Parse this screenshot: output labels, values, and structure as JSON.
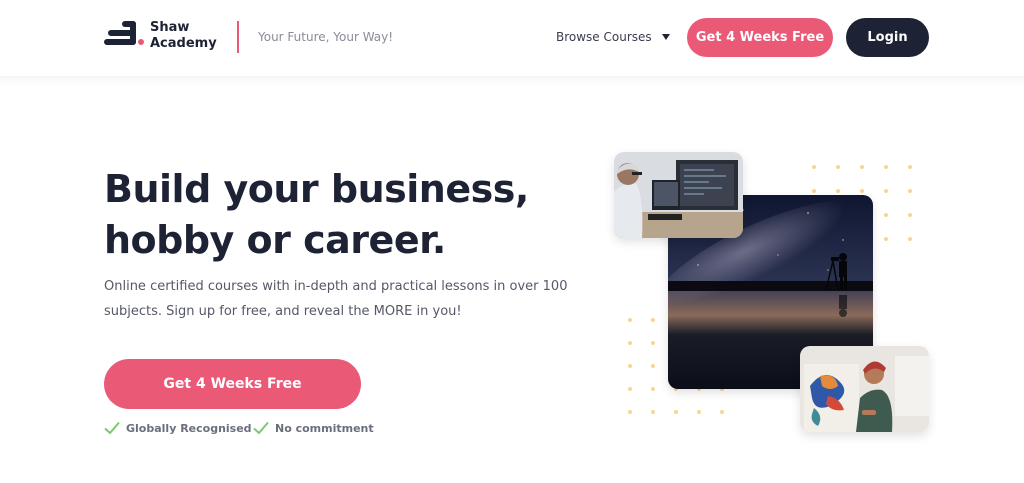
{
  "header": {
    "logo_line1": "Shaw",
    "logo_line2": "Academy",
    "tagline": "Your Future, Your Way!",
    "browse_label": "Browse Courses",
    "cta_label": "Get 4 Weeks Free",
    "login_label": "Login"
  },
  "hero": {
    "title_line1": "Build your business,",
    "title_line2": "hobby or career.",
    "subtitle_line1": "Online certified courses with in-depth and practical lessons in over 100",
    "subtitle_line2": "subjects. Sign up for free, and reveal the MORE in you!",
    "cta_label": "Get 4 Weeks Free",
    "checks": [
      "Globally Recognised",
      "No commitment"
    ]
  },
  "colors": {
    "accent": "#ea5a77",
    "navy": "#1e2235",
    "check": "#7bc96f",
    "dots": "#fbd48d"
  },
  "images": {
    "top_left": "person-at-computer",
    "center": "photographer-night-sky",
    "bottom_right": "woman-painting"
  }
}
